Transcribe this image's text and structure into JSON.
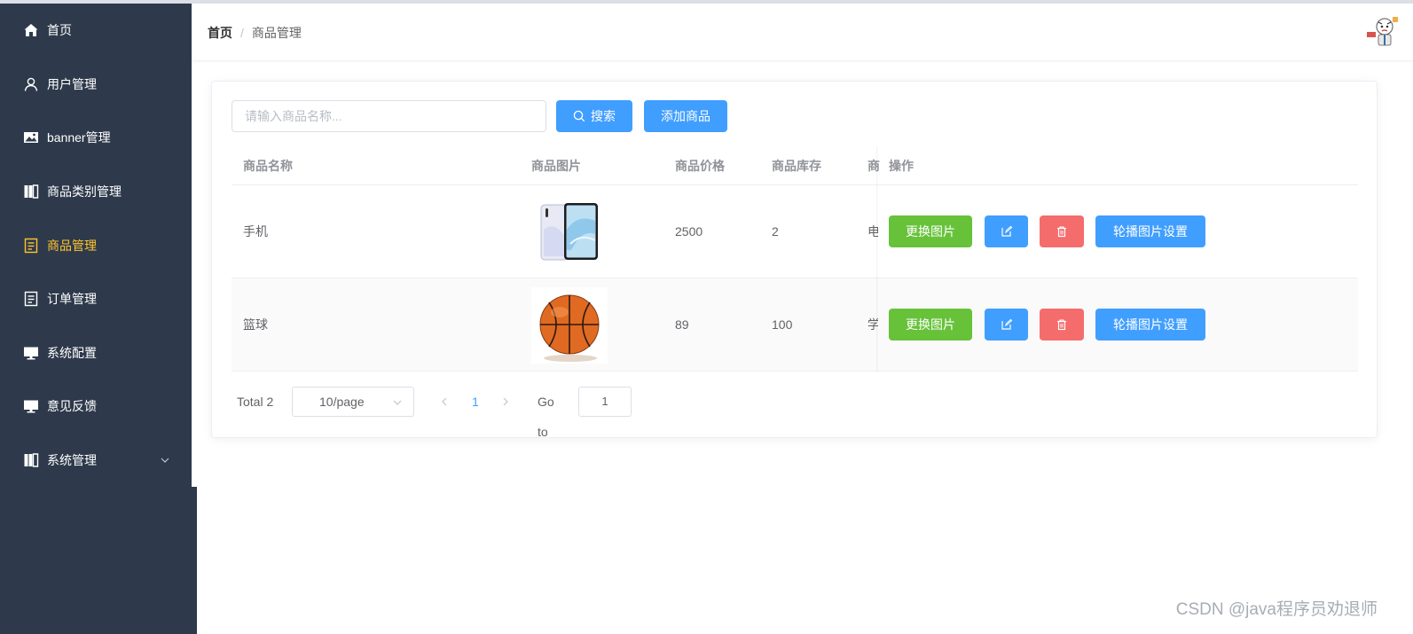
{
  "sidebar": {
    "items": [
      {
        "label": "首页",
        "icon": "home-icon",
        "active": false
      },
      {
        "label": "用户管理",
        "icon": "user-icon",
        "active": false
      },
      {
        "label": "banner管理",
        "icon": "image-icon",
        "active": false
      },
      {
        "label": "商品类别管理",
        "icon": "collection-icon",
        "active": false
      },
      {
        "label": "商品管理",
        "icon": "document-icon",
        "active": true
      },
      {
        "label": "订单管理",
        "icon": "document-icon",
        "active": false
      },
      {
        "label": "系统配置",
        "icon": "monitor-icon",
        "active": false
      },
      {
        "label": "意见反馈",
        "icon": "monitor-icon",
        "active": false
      },
      {
        "label": "系统管理",
        "icon": "collection-icon",
        "active": false,
        "expandable": true
      }
    ],
    "colors": {
      "bg": "#2e3a4b",
      "text": "#ffffff",
      "active": "#ffc430"
    }
  },
  "header": {
    "breadcrumb": {
      "home": "首页",
      "separator": "/",
      "current": "商品管理"
    }
  },
  "toolbar": {
    "search_placeholder": "请输入商品名称...",
    "search_value": "",
    "search_label": "搜索",
    "add_label": "添加商品"
  },
  "table": {
    "columns": {
      "name": "商品名称",
      "image": "商品图片",
      "price": "商品价格",
      "stock": "商品库存",
      "category_partial": "商",
      "actions": "操作"
    },
    "rows": [
      {
        "name": "手机",
        "image": "phone-image",
        "price": "2500",
        "stock": "2",
        "category_partial": "电"
      },
      {
        "name": "篮球",
        "image": "basketball-image",
        "price": "89",
        "stock": "100",
        "category_partial": "学"
      }
    ],
    "actions": {
      "change_image": "更换图片",
      "edit_icon": "edit-icon",
      "delete_icon": "delete-icon",
      "carousel_settings": "轮播图片设置"
    }
  },
  "pagination": {
    "total": "Total 2",
    "page_size": "10/page",
    "current_page": "1",
    "goto_label": "Go to",
    "goto_value": "1"
  },
  "watermark": "CSDN @java程序员劝退师",
  "colors": {
    "primary": "#409eff",
    "success": "#67c23a",
    "danger": "#f56c6c"
  }
}
